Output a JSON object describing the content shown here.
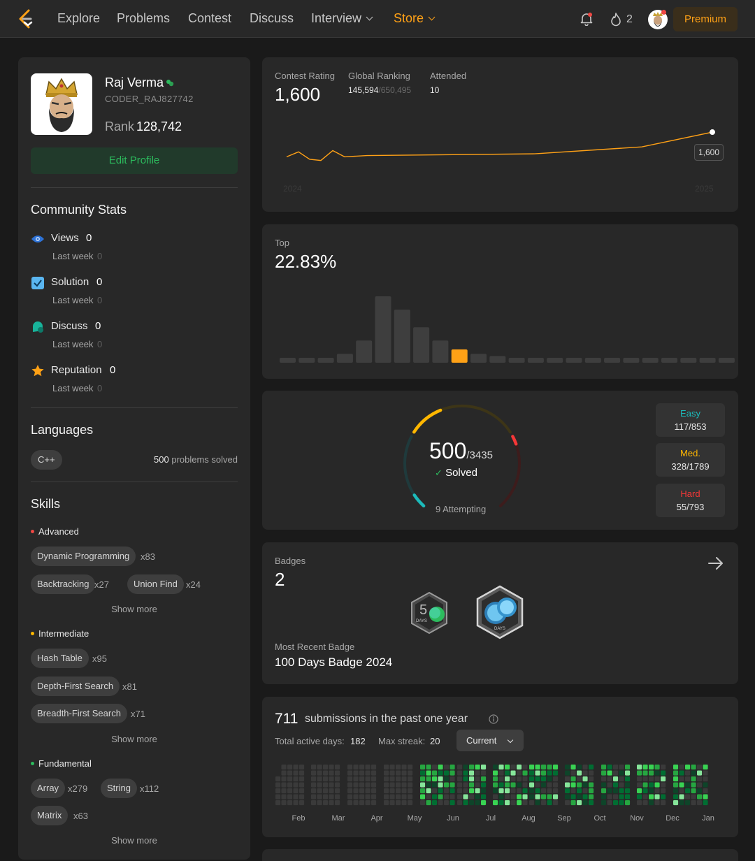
{
  "nav": {
    "items": [
      "Explore",
      "Problems",
      "Contest",
      "Discuss",
      "Interview",
      "Store"
    ],
    "streak": "2",
    "premium": "Premium"
  },
  "profile": {
    "name": "Raj Verma",
    "username": "CODER_RAJ827742",
    "rank_label": "Rank",
    "rank_value": "128,742",
    "edit_button": "Edit Profile"
  },
  "community": {
    "title": "Community Stats",
    "stats": [
      {
        "label": "Views",
        "value": "0",
        "sub_label": "Last week",
        "sub_value": "0"
      },
      {
        "label": "Solution",
        "value": "0",
        "sub_label": "Last week",
        "sub_value": "0"
      },
      {
        "label": "Discuss",
        "value": "0",
        "sub_label": "Last week",
        "sub_value": "0"
      },
      {
        "label": "Reputation",
        "value": "0",
        "sub_label": "Last week",
        "sub_value": "0"
      }
    ]
  },
  "languages": {
    "title": "Languages",
    "lang": "C++",
    "count": "500",
    "suffix": "problems solved"
  },
  "skills": {
    "title": "Skills",
    "show_more": "Show more",
    "advanced": {
      "label": "Advanced",
      "items": [
        {
          "name": "Dynamic Programming",
          "count": "x83"
        },
        {
          "name": "Backtracking",
          "count": "x27"
        },
        {
          "name": "Union Find",
          "count": "x24"
        }
      ]
    },
    "intermediate": {
      "label": "Intermediate",
      "items": [
        {
          "name": "Hash Table",
          "count": "x95"
        },
        {
          "name": "Depth-First Search",
          "count": "x81"
        },
        {
          "name": "Breadth-First Search",
          "count": "x71"
        }
      ]
    },
    "fundamental": {
      "label": "Fundamental",
      "items": [
        {
          "name": "Array",
          "count": "x279"
        },
        {
          "name": "String",
          "count": "x112"
        },
        {
          "name": "Matrix",
          "count": "x63"
        }
      ]
    }
  },
  "contest": {
    "rating_label": "Contest Rating",
    "rating": "1,600",
    "global_label": "Global Ranking",
    "global_rank": "145,594",
    "global_total": "/650,495",
    "attended_label": "Attended",
    "attended": "10",
    "tooltip": "1,600",
    "year_start": "2024",
    "year_end": "2025"
  },
  "top": {
    "label": "Top",
    "value": "22.83%"
  },
  "solved": {
    "count": "500",
    "total": "/3435",
    "solved_label": "Solved",
    "attempting": "9 Attempting",
    "easy_label": "Easy",
    "easy": "117/853",
    "med_label": "Med.",
    "med": "328/1789",
    "hard_label": "Hard",
    "hard": "55/793",
    "fractions": {
      "easy": 0.137,
      "med": 0.183,
      "hard": 0.069
    }
  },
  "badges": {
    "label": "Badges",
    "count": "2",
    "recent_label": "Most Recent Badge",
    "recent": "100 Days Badge 2024",
    "badge1_text": "DAYS",
    "badge2_text": "DAYS"
  },
  "submissions": {
    "count": "711",
    "text": "submissions in the past one year",
    "active_label": "Total active days:",
    "active": "182",
    "streak_label": "Max streak:",
    "streak": "20",
    "dropdown": "Current",
    "months": [
      "Feb",
      "Mar",
      "Apr",
      "May",
      "Jun",
      "Jul",
      "Aug",
      "Sep",
      "Oct",
      "Nov",
      "Dec",
      "Jan"
    ]
  },
  "chart_data": [
    {
      "type": "line",
      "x": [
        "2024",
        "",
        "",
        "",
        "",
        "",
        "",
        "",
        "",
        "2025"
      ],
      "values": [
        1500,
        1520,
        1490,
        1485,
        1525,
        1500,
        1505,
        1512,
        1540,
        1600
      ]
    },
    {
      "type": "bar",
      "values": [
        1,
        1,
        1,
        2,
        5,
        15,
        12,
        8,
        5,
        3,
        2,
        1.5,
        1,
        1,
        1,
        1,
        1,
        1,
        1,
        1,
        1,
        1,
        1,
        1
      ],
      "highlight_index": 9
    }
  ],
  "colors": {
    "accent": "#ffa116",
    "easy": "#1cbaba",
    "medium": "#ffb700",
    "hard": "#f63737",
    "green": "#2cbb5d"
  }
}
